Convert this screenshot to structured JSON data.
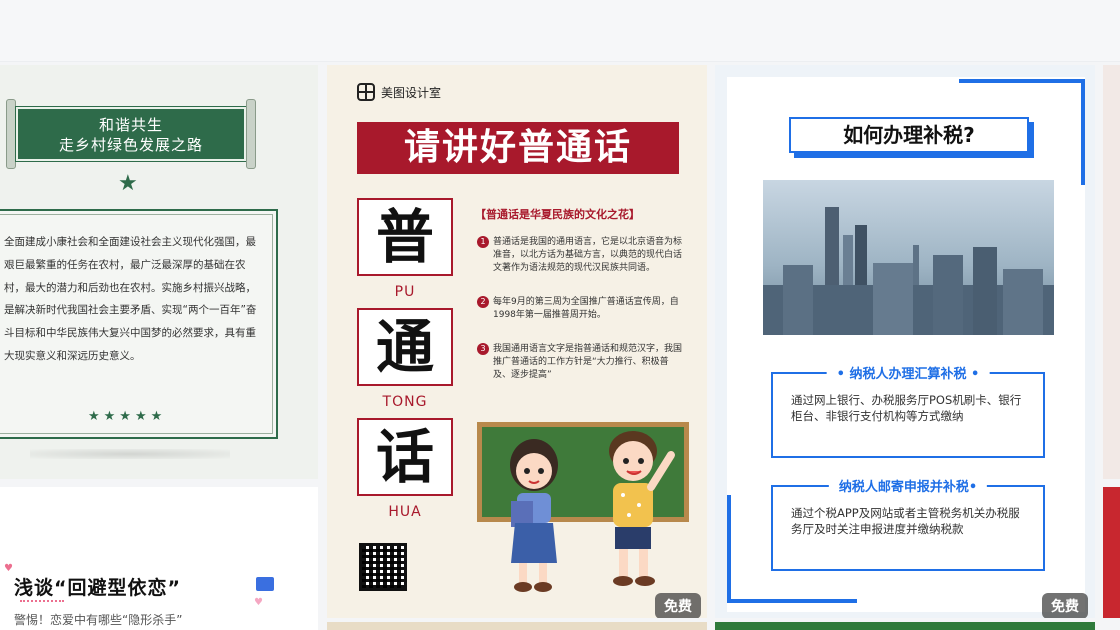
{
  "cards": {
    "c1": {
      "scroll_line1": "和谐共生",
      "scroll_line2": "走乡村绿色发展之路",
      "paragraph": "全面建成小康社会和全面建设社会主义现代化强国，最艰巨最繁重的任务在农村，最广泛最深厚的基础在农村，最大的潜力和后劲也在农村。实施乡村振兴战略，是解决新时代我国社会主要矛盾、实现“两个一百年”奋斗目标和中华民族伟大复兴中国梦的必然要求，具有重大现实意义和深远历史意义。"
    },
    "c2": {
      "title": "浅谈“回避型依恋”",
      "subtitle": "警惕！恋爱中有哪些“隐形杀手”"
    },
    "c3": {
      "brand": "美图设计室",
      "title": "请讲好普通话",
      "chars": [
        {
          "char": "普",
          "pinyin": "PU"
        },
        {
          "char": "通",
          "pinyin": "TONG"
        },
        {
          "char": "话",
          "pinyin": "HUA"
        }
      ],
      "section_title": "【普通话是华夏民族的文化之花】",
      "points": [
        {
          "num": "1",
          "text": "普通话是我国的通用语言，它是以北京语音为标准音，以北方话为基础方言，以典范的现代白话文著作为语法规范的现代汉民族共同语。"
        },
        {
          "num": "2",
          "text": "每年9月的第三周为全国推广普通话宣传周，自1998年第一届推普周开始。"
        },
        {
          "num": "3",
          "text": "我国通用语言文字是指普通话和规范汉字，我国推广普通话的工作方针是“大力推行、积极普及、逐步提高”"
        }
      ],
      "badge": "免费"
    },
    "c4": {
      "title": "如何办理补税?",
      "box1_title": "• 纳税人办理汇算补税 •",
      "box1_body": "通过网上银行、办税服务厅POS机刷卡、银行柜台、非银行支付机构等方式缴纳",
      "box2_title": "纳税人邮寄申报并补税•",
      "box2_body": "通过个税APP及网站或者主管税务机关办税服务厅及时关注申报进度并缴纳税款",
      "badge": "免费"
    }
  },
  "colors": {
    "green": "#2e6b4a",
    "red": "#a8192c",
    "blue": "#1f6fe6"
  }
}
